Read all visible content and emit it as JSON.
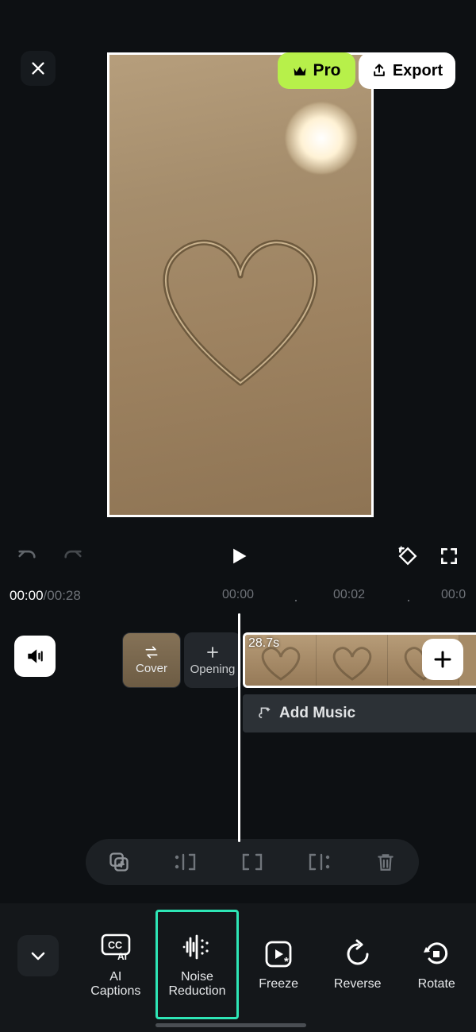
{
  "header": {
    "pro_label": "Pro",
    "export_label": "Export"
  },
  "controls": {},
  "time": {
    "current": "00:00",
    "duration": "00:28",
    "ticks": [
      "00:00",
      "00:02",
      "00:0"
    ]
  },
  "timeline": {
    "cover_label": "Cover",
    "opening_label": "Opening",
    "clip_duration": "28.7s",
    "add_music_label": "Add Music"
  },
  "bottom_tools": [
    {
      "id": "ai-captions",
      "label": "AI\nCaptions"
    },
    {
      "id": "noise-reduction",
      "label": "Noise\nReduction",
      "selected": true
    },
    {
      "id": "freeze",
      "label": "Freeze"
    },
    {
      "id": "reverse",
      "label": "Reverse"
    },
    {
      "id": "rotate",
      "label": "Rotate"
    }
  ]
}
